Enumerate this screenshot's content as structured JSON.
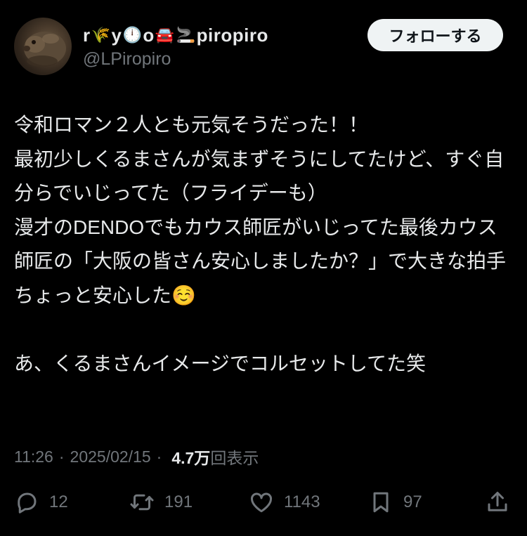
{
  "user": {
    "display_name_parts": [
      "r",
      "🌾",
      "y",
      "🕛",
      "o",
      "🚘",
      "🚬",
      "piropiro"
    ],
    "handle": "@LPiropiro",
    "follow_label": "フォローする"
  },
  "tweet": {
    "text": "令和ロマン２人とも元気そうだった！！\n最初少しくるまさんが気まずそうにしてたけど、すぐ自分らでいじってた（フライデーも）\n漫才のDENDOでもカウス師匠がいじってた最後カウス師匠の「大阪の皆さん安心しましたか？」で大きな拍手\nちょっと安心した☺️\n\nあ、くるまさんイメージでコルセットしてた笑",
    "time": "11:26",
    "date": "2025/02/15",
    "separator": "·",
    "views_count": "4.7万",
    "views_label": "回表示"
  },
  "actions": {
    "replies": "12",
    "retweets": "191",
    "likes": "1143",
    "bookmarks": "97"
  },
  "icons": {
    "reply": "reply-icon",
    "retweet": "retweet-icon",
    "like": "heart-icon",
    "bookmark": "bookmark-icon",
    "share": "share-icon"
  },
  "colors": {
    "background": "#000000",
    "text": "#e7e9ea",
    "muted": "#71767b",
    "follow_bg": "#eff3f4"
  }
}
